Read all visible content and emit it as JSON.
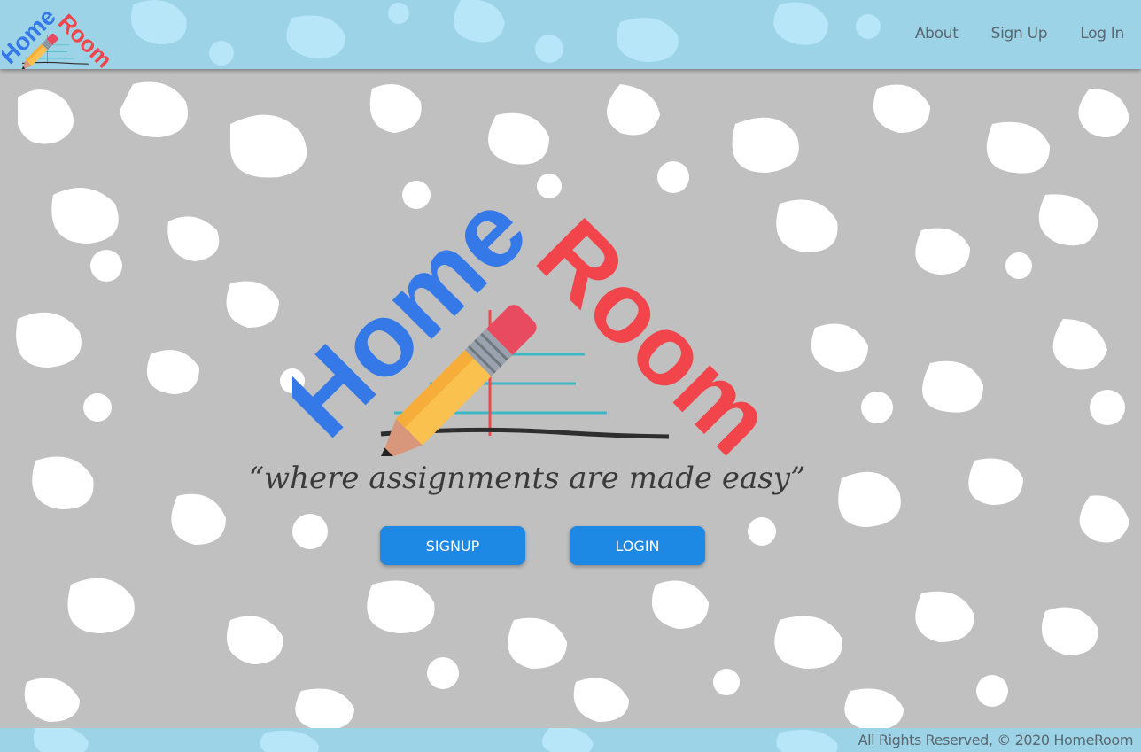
{
  "app": {
    "brand_home": "Home",
    "brand_room": "Room"
  },
  "nav": {
    "links": [
      {
        "label": "About"
      },
      {
        "label": "Sign Up"
      },
      {
        "label": "Log In"
      }
    ]
  },
  "hero": {
    "tagline": "“where assignments are made easy”",
    "signup_label": "SIGNUP",
    "login_label": "LOGIN"
  },
  "footer": {
    "text": "All Rights Reserved, © 2020 HomeRoom"
  },
  "colors": {
    "navbar": "#9dd3e6",
    "background": "#c0c0c0",
    "button": "#1e88e5",
    "brand_blue": "#3579e8",
    "brand_red": "#f2454b"
  }
}
